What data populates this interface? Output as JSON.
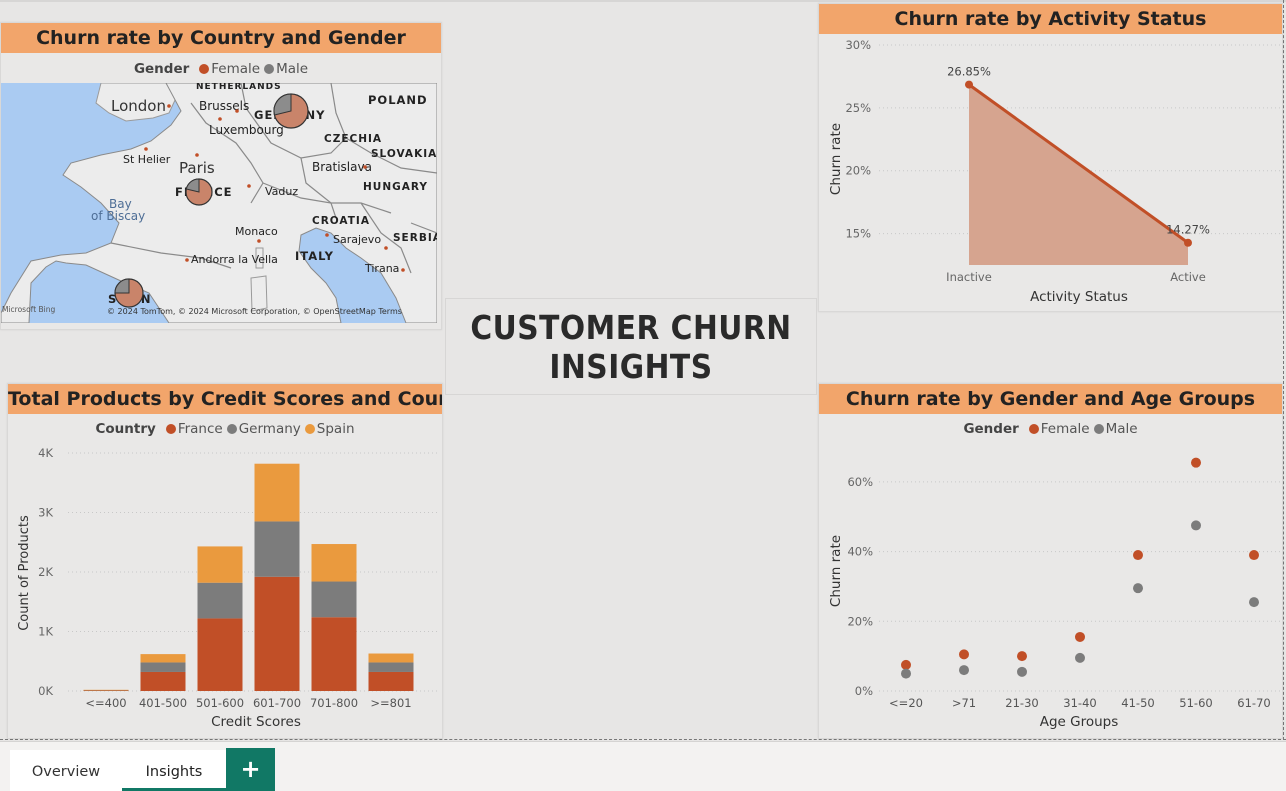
{
  "title": {
    "line1": "CUSTOMER CHURN",
    "line2": "INSIGHTS"
  },
  "colors": {
    "female": "#c14f27",
    "male": "#7c7c7c",
    "france": "#c14f27",
    "germany": "#7c7c7c",
    "spain": "#ea9a3e",
    "header": "#f2a56b",
    "tab_accent": "#117865"
  },
  "map_card": {
    "title": "Churn rate by Country and Gender",
    "legend": {
      "label": "Gender",
      "items": [
        "Female",
        "Male"
      ]
    },
    "labels": {
      "london": "London",
      "brussels": "Brussels",
      "luxembourg": "Luxembourg",
      "germany": "GERMANY",
      "poland": "POLAND",
      "czechia": "CZECHIA",
      "slovakia": "SLOVAKIA",
      "st_helier": "St Helier",
      "paris": "Paris",
      "france": "FRANCE",
      "bratislava": "Bratislava",
      "hungary": "HUNGARY",
      "vaduz": "Vaduz",
      "bay": "Bay",
      "of_biscay": "of Biscay",
      "croatia": "CROATIA",
      "monaco": "Monaco",
      "sarajevo": "Sarajevo",
      "serbia": "SERBIA",
      "andorra": "Andorra la Vella",
      "italy": "ITALY",
      "tirana": "Tirana",
      "spain": "SPAIN",
      "netherlands": "NETHERLANDS",
      "microsoft_bing": "Microsoft Bing",
      "copyright": "© 2024 TomTom, © 2024 Microsoft Corporation, © OpenStreetMap  Terms"
    }
  },
  "activity_card": {
    "title": "Churn rate by Activity Status",
    "xlabel": "Activity Status",
    "ylabel": "Churn rate",
    "yticks": [
      "30%",
      "25%",
      "20%",
      "15%"
    ],
    "labels": [
      "26.85%",
      "14.27%"
    ]
  },
  "products_card": {
    "title": "Total Products by Credit Scores and Country",
    "legend": {
      "label": "Country",
      "items": [
        "France",
        "Germany",
        "Spain"
      ]
    },
    "xlabel": "Credit Scores",
    "ylabel": "Count of Products",
    "yticks": [
      "4K",
      "3K",
      "2K",
      "1K",
      "0K"
    ]
  },
  "age_card": {
    "title": "Churn rate by Gender and Age Groups",
    "legend": {
      "label": "Gender",
      "items": [
        "Female",
        "Male"
      ]
    },
    "xlabel": "Age Groups",
    "ylabel": "Churn rate",
    "yticks": [
      "60%",
      "40%",
      "20%",
      "0%"
    ]
  },
  "chart_data": [
    {
      "type": "area",
      "title": "Churn rate by Activity Status",
      "xlabel": "Activity Status",
      "ylabel": "Churn rate",
      "categories": [
        "Inactive",
        "Active"
      ],
      "values": [
        26.85,
        14.27
      ],
      "data_labels": [
        "26.85%",
        "14.27%"
      ],
      "ylim": [
        12.5,
        30
      ],
      "grid": true
    },
    {
      "type": "bar",
      "stacked": true,
      "title": "Total Products by Credit Scores and Country",
      "xlabel": "Credit Scores",
      "ylabel": "Count of Products",
      "categories": [
        "<=400",
        "401-500",
        "501-600",
        "601-700",
        "701-800",
        ">=801"
      ],
      "series": [
        {
          "name": "France",
          "values": [
            10,
            320,
            1220,
            1920,
            1240,
            320
          ]
        },
        {
          "name": "Germany",
          "values": [
            5,
            160,
            600,
            930,
            600,
            160
          ]
        },
        {
          "name": "Spain",
          "values": [
            5,
            140,
            610,
            970,
            630,
            150
          ]
        }
      ],
      "ylim": [
        0,
        4000
      ],
      "legend": "top",
      "grid": true
    },
    {
      "type": "scatter",
      "title": "Churn rate by Gender and Age Groups",
      "xlabel": "Age Groups",
      "ylabel": "Churn rate",
      "categories": [
        "<=20",
        ">71",
        "21-30",
        "31-40",
        "41-50",
        "51-60",
        "61-70"
      ],
      "series": [
        {
          "name": "Female",
          "values": [
            7.5,
            10.5,
            10,
            15.5,
            39,
            65.5,
            39
          ]
        },
        {
          "name": "Male",
          "values": [
            5,
            6,
            5.5,
            9.5,
            29.5,
            47.5,
            25.5
          ]
        }
      ],
      "ylim": [
        0,
        70
      ],
      "legend": "top",
      "grid": true
    }
  ],
  "tabs": [
    {
      "label": "Overview",
      "active": false
    },
    {
      "label": "Insights",
      "active": true
    }
  ],
  "add_tab_label": "+"
}
